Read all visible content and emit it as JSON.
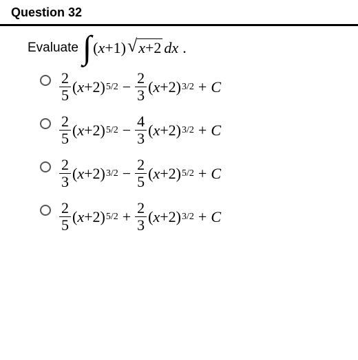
{
  "header": {
    "title": "Question 32"
  },
  "prompt": {
    "label": "Evaluate",
    "integral": {
      "symbol": "∫",
      "open": "(",
      "inner1": "x",
      "plus1": "+",
      "inner2": "1",
      "close": ")",
      "sqrt": {
        "radical": "√",
        "arg_x": "x",
        "arg_plus": "+",
        "arg_two": "2"
      },
      "dx": "dx",
      "dot": "."
    }
  },
  "options": [
    {
      "f1": {
        "num": "2",
        "den": "5"
      },
      "t1": {
        "open": "(",
        "x": "x",
        "plus": "+",
        "two": "2",
        "close": ")",
        "exp": "5/2"
      },
      "op1": "−",
      "f2": {
        "num": "2",
        "den": "3"
      },
      "t2": {
        "open": "(",
        "x": "x",
        "plus": "+",
        "two": "2",
        "close": ")",
        "exp": "3/2"
      },
      "op2": "+",
      "c": "C"
    },
    {
      "f1": {
        "num": "2",
        "den": "5"
      },
      "t1": {
        "open": "(",
        "x": "x",
        "plus": "+",
        "two": "2",
        "close": ")",
        "exp": "5/2"
      },
      "op1": "−",
      "f2": {
        "num": "4",
        "den": "3"
      },
      "t2": {
        "open": "(",
        "x": "x",
        "plus": "+",
        "two": "2",
        "close": ")",
        "exp": "3/2"
      },
      "op2": "+",
      "c": "C"
    },
    {
      "f1": {
        "num": "2",
        "den": "3"
      },
      "t1": {
        "open": "(",
        "x": "x",
        "plus": "+",
        "two": "2",
        "close": ")",
        "exp": "3/2"
      },
      "op1": "−",
      "f2": {
        "num": "2",
        "den": "5"
      },
      "t2": {
        "open": "(",
        "x": "x",
        "plus": "+",
        "two": "2",
        "close": ")",
        "exp": "5/2"
      },
      "op2": "+",
      "c": "C"
    },
    {
      "f1": {
        "num": "2",
        "den": "5"
      },
      "t1": {
        "open": "(",
        "x": "x",
        "plus": "+",
        "two": "2",
        "close": ")",
        "exp": "5/2"
      },
      "op1": "+",
      "f2": {
        "num": "2",
        "den": "3"
      },
      "t2": {
        "open": "(",
        "x": "x",
        "plus": "+",
        "two": "2",
        "close": ")",
        "exp": "3/2"
      },
      "op2": "+",
      "c": "C"
    }
  ]
}
